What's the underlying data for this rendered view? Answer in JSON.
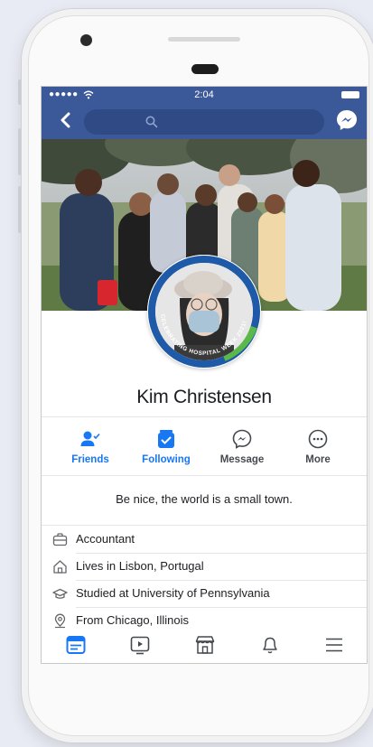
{
  "status_bar": {
    "signal": "●●●●● ",
    "time": "2:04"
  },
  "profile": {
    "name": "Kim Christensen",
    "frame_text": "CELEBRATING HOSPITAL WEEK 2021!",
    "bio": "Be nice, the world is a small town."
  },
  "actions": [
    {
      "label": "Friends",
      "icon": "friends-icon",
      "color": "#1877f2"
    },
    {
      "label": "Following",
      "icon": "following-icon",
      "color": "#1877f2"
    },
    {
      "label": "Message",
      "icon": "messenger-icon",
      "color": "#444950"
    },
    {
      "label": "More",
      "icon": "more-icon",
      "color": "#444950"
    }
  ],
  "about": [
    {
      "text": "Accountant",
      "icon": "briefcase-icon"
    },
    {
      "text": "Lives in Lisbon, Portugal",
      "icon": "home-icon"
    },
    {
      "text": "Studied at University of Pennsylvania",
      "icon": "graduation-cap-icon"
    },
    {
      "text": "From Chicago, Illinois",
      "icon": "location-pin-icon"
    }
  ],
  "tabs": [
    {
      "icon": "news-feed-icon",
      "active": true
    },
    {
      "icon": "watch-icon",
      "active": false
    },
    {
      "icon": "marketplace-icon",
      "active": false
    },
    {
      "icon": "notifications-icon",
      "active": false
    },
    {
      "icon": "menu-icon",
      "active": false
    }
  ],
  "colors": {
    "brand": "#3b5998",
    "accent": "#1877f2",
    "frame_blue": "#1f5aa8",
    "frame_green": "#5bb84a"
  }
}
